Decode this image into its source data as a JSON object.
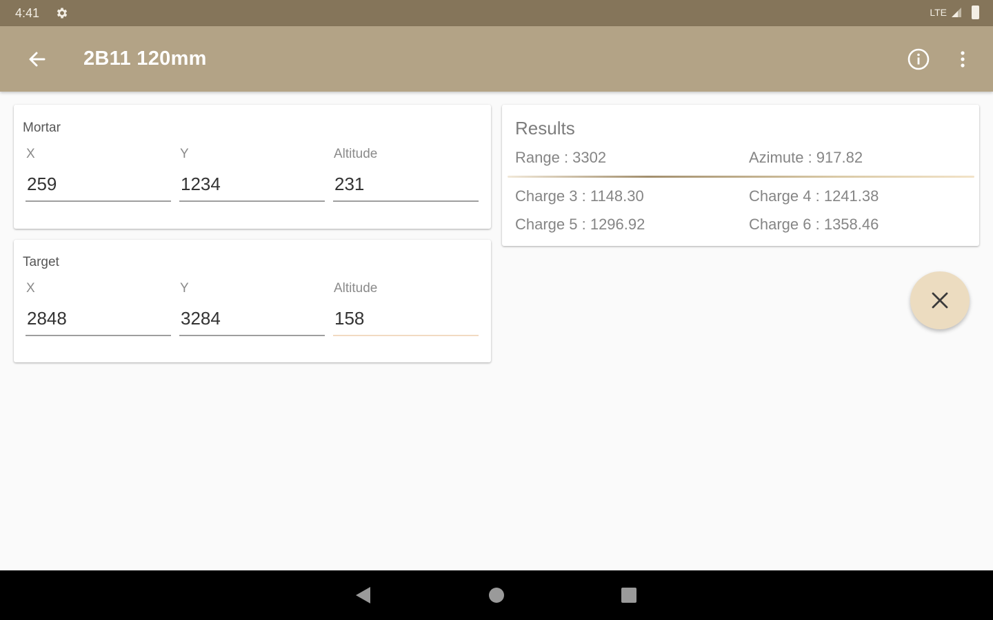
{
  "status_bar": {
    "time": "4:41",
    "network": "LTE",
    "gear_icon": "gear-icon",
    "signal_icon": "cell-signal-icon",
    "battery_icon": "battery-icon"
  },
  "app_bar": {
    "title": "2B11 120mm",
    "back_icon": "arrow-back-icon",
    "info_icon": "info-icon",
    "more_icon": "more-vert-icon"
  },
  "mortar": {
    "title": "Mortar",
    "x_label": "X",
    "y_label": "Y",
    "altitude_label": "Altitude",
    "x_value": "259",
    "y_value": "1234",
    "altitude_value": "231"
  },
  "target": {
    "title": "Target",
    "x_label": "X",
    "y_label": "Y",
    "altitude_label": "Altitude",
    "x_value": "2848",
    "y_value": "3284",
    "altitude_value": "158"
  },
  "results": {
    "title": "Results",
    "range": "Range : 3302",
    "azimute": "Azimute : 917.82",
    "charge3": "Charge 3 : 1148.30",
    "charge4": "Charge 4 : 1241.38",
    "charge5": "Charge 5 : 1296.92",
    "charge6": "Charge 6 : 1358.46"
  },
  "fab": {
    "icon": "close-icon"
  },
  "nav_bar": {
    "back_icon": "nav-back-icon",
    "home_icon": "nav-home-icon",
    "recents_icon": "nav-recents-icon"
  },
  "colors": {
    "status_bar": "#85755a",
    "app_bar": "#b3a386",
    "fab": "#ecdcc0",
    "active_underline": "#f2dac2",
    "background": "#fafafa"
  }
}
